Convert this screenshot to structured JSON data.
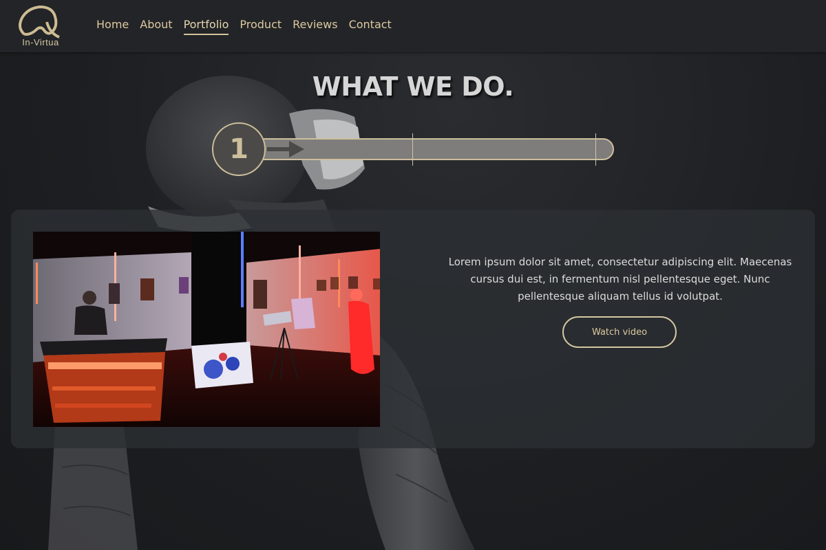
{
  "brand": {
    "name": "In-Virtua",
    "accent": "#d7c39a"
  },
  "nav": {
    "items": [
      {
        "label": "Home"
      },
      {
        "label": "About"
      },
      {
        "label": "Portfolio",
        "active": true
      },
      {
        "label": "Product"
      },
      {
        "label": "Reviews"
      },
      {
        "label": "Contact"
      }
    ]
  },
  "section": {
    "title": "WHAT WE DO."
  },
  "progress": {
    "current_step": "1",
    "total_steps": 3
  },
  "feature": {
    "description": "Lorem ipsum dolor sit amet, consectetur adipiscing elit. Maecenas cursus dui est, in fermentum nisl pellentesque eget. Nunc pellentesque aliquam tellus id volutpat.",
    "button_label": "Watch video"
  }
}
